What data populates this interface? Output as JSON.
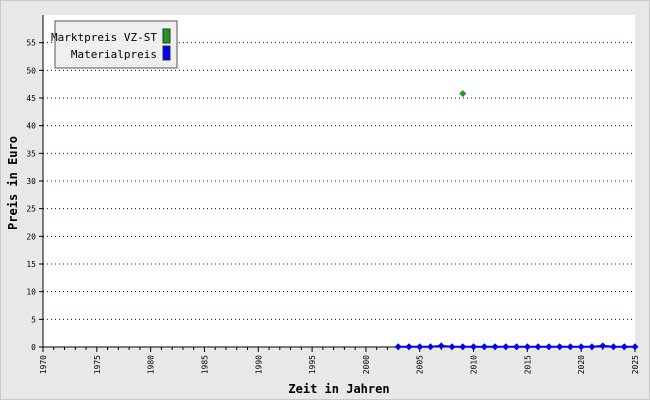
{
  "chart_data": {
    "type": "scatter",
    "xlabel": "Zeit in Jahren",
    "ylabel": "Preis in Euro",
    "xlim": [
      1970,
      2025
    ],
    "ylim": [
      0,
      60
    ],
    "xticks": [
      1970,
      1975,
      1980,
      1985,
      1990,
      1995,
      2000,
      2005,
      2010,
      2015,
      2020,
      2025
    ],
    "yticks": [
      0,
      5,
      10,
      15,
      20,
      25,
      30,
      35,
      40,
      45,
      50,
      55
    ],
    "grid": "horizontal-dotted",
    "legend": "top-left",
    "series": [
      {
        "name": "Marktpreis VZ-ST",
        "color": "#1e9a1e",
        "marker": "diamond",
        "connect": false,
        "points": [
          [
            2009,
            45.8
          ]
        ]
      },
      {
        "name": "Materialpreis",
        "color": "#0000ee",
        "marker": "diamond",
        "connect": true,
        "points": [
          [
            2003,
            0.05
          ],
          [
            2004,
            0.05
          ],
          [
            2005,
            0.05
          ],
          [
            2006,
            0.05
          ],
          [
            2007,
            0.2
          ],
          [
            2008,
            0.05
          ],
          [
            2009,
            0.05
          ],
          [
            2010,
            0.05
          ],
          [
            2011,
            0.05
          ],
          [
            2012,
            0.05
          ],
          [
            2013,
            0.05
          ],
          [
            2014,
            0.05
          ],
          [
            2015,
            0.05
          ],
          [
            2016,
            0.05
          ],
          [
            2017,
            0.05
          ],
          [
            2018,
            0.05
          ],
          [
            2019,
            0.05
          ],
          [
            2020,
            0.05
          ],
          [
            2021,
            0.05
          ],
          [
            2022,
            0.2
          ],
          [
            2023,
            0.05
          ],
          [
            2024,
            0.05
          ],
          [
            2025,
            0.05
          ]
        ]
      }
    ]
  }
}
